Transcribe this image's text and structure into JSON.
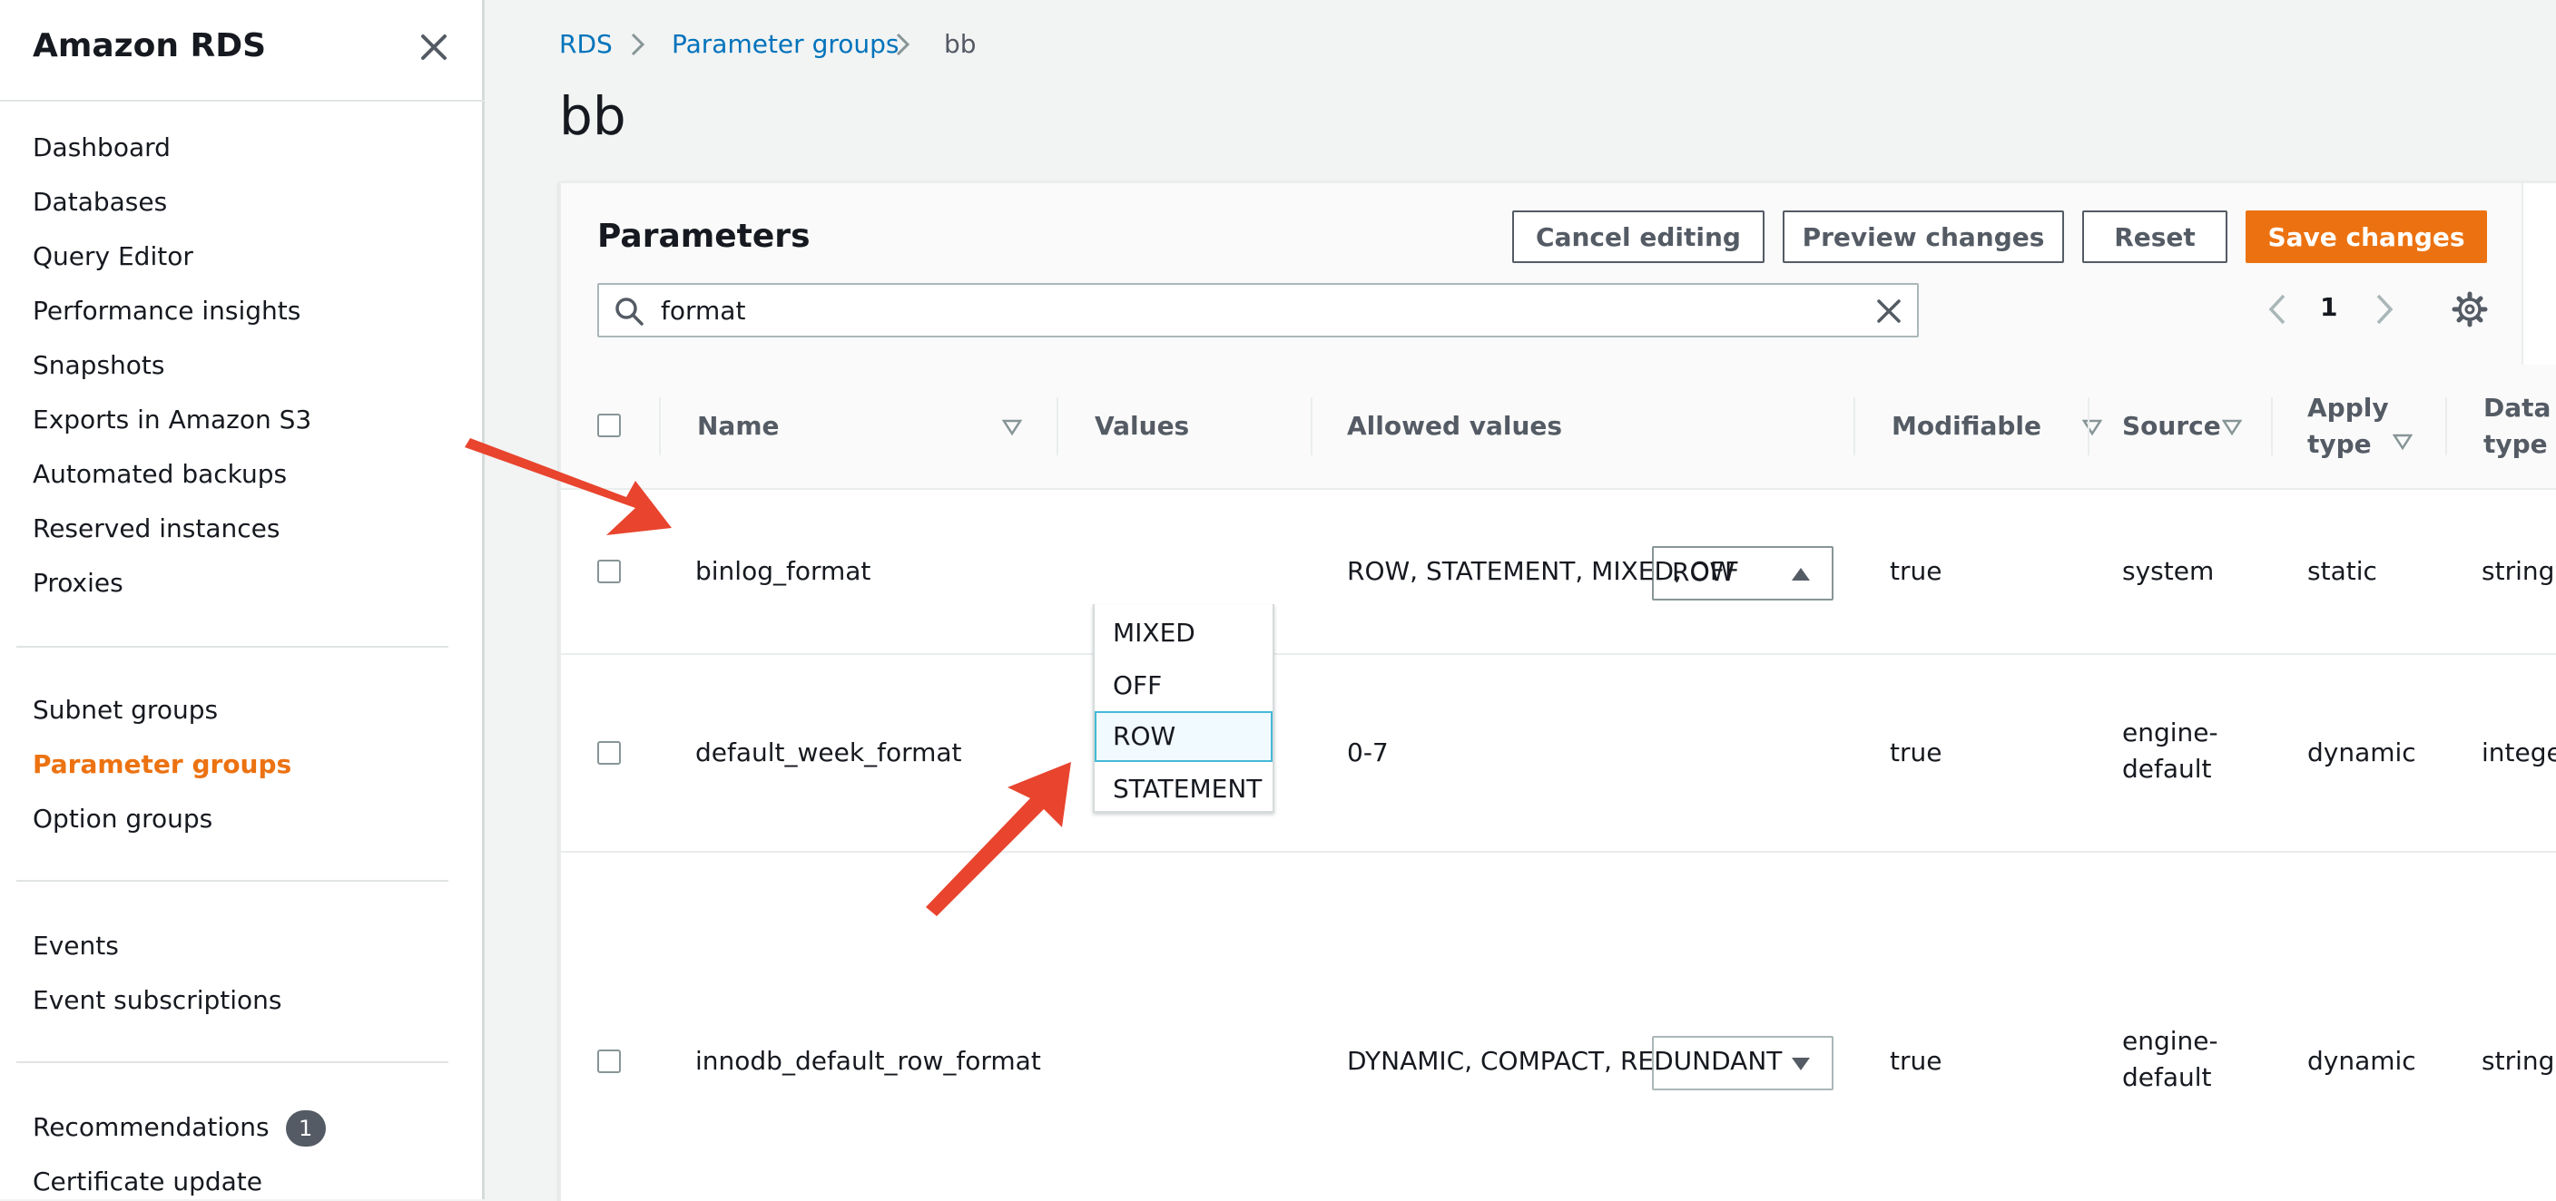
{
  "sidebar": {
    "title": "Amazon RDS",
    "nav_primary": [
      "Dashboard",
      "Databases",
      "Query Editor",
      "Performance insights",
      "Snapshots",
      "Exports in Amazon S3",
      "Automated backups",
      "Reserved instances",
      "Proxies"
    ],
    "nav_groups": [
      "Subnet groups",
      "Parameter groups",
      "Option groups"
    ],
    "nav_events": [
      "Events",
      "Event subscriptions"
    ],
    "nav_more": [
      "Recommendations",
      "Certificate update"
    ],
    "recommendations_badge": "1",
    "active_item": "Parameter groups"
  },
  "breadcrumb": [
    "RDS",
    "Parameter groups",
    "bb"
  ],
  "page_title": "bb",
  "panel": {
    "title": "Parameters",
    "buttons": {
      "cancel": "Cancel editing",
      "preview": "Preview changes",
      "reset": "Reset",
      "save": "Save changes"
    },
    "search_value": "format",
    "page_number": "1"
  },
  "table": {
    "columns": {
      "name": "Name",
      "values": "Values",
      "allowed": "Allowed values",
      "modifiable": "Modifiable",
      "source": "Source",
      "apply_1": "Apply",
      "apply_2": "type",
      "data_1": "Data",
      "data_2": "type"
    },
    "rows": [
      {
        "name": "binlog_format",
        "value": "ROW",
        "allowed": "ROW, STATEMENT, MIXED, OFF",
        "modifiable": "true",
        "source_1": "system",
        "source_2": "",
        "apply": "static",
        "data": "string"
      },
      {
        "name": "default_week_format",
        "value": "",
        "allowed": "0-7",
        "modifiable": "true",
        "source_1": "engine-",
        "source_2": "default",
        "apply": "dynamic",
        "data": "integer"
      },
      {
        "name": "innodb_default_row_format",
        "value": "",
        "allowed": "DYNAMIC, COMPACT, REDUNDANT",
        "modifiable": "true",
        "source_1": "engine-",
        "source_2": "default",
        "apply": "dynamic",
        "data": "string"
      }
    ]
  },
  "dropdown": {
    "options": [
      "MIXED",
      "OFF",
      "ROW",
      "STATEMENT"
    ],
    "selected": "ROW"
  },
  "colors": {
    "accent": "#ec7211",
    "link": "#0073bb",
    "annotation": "#e8442e"
  }
}
